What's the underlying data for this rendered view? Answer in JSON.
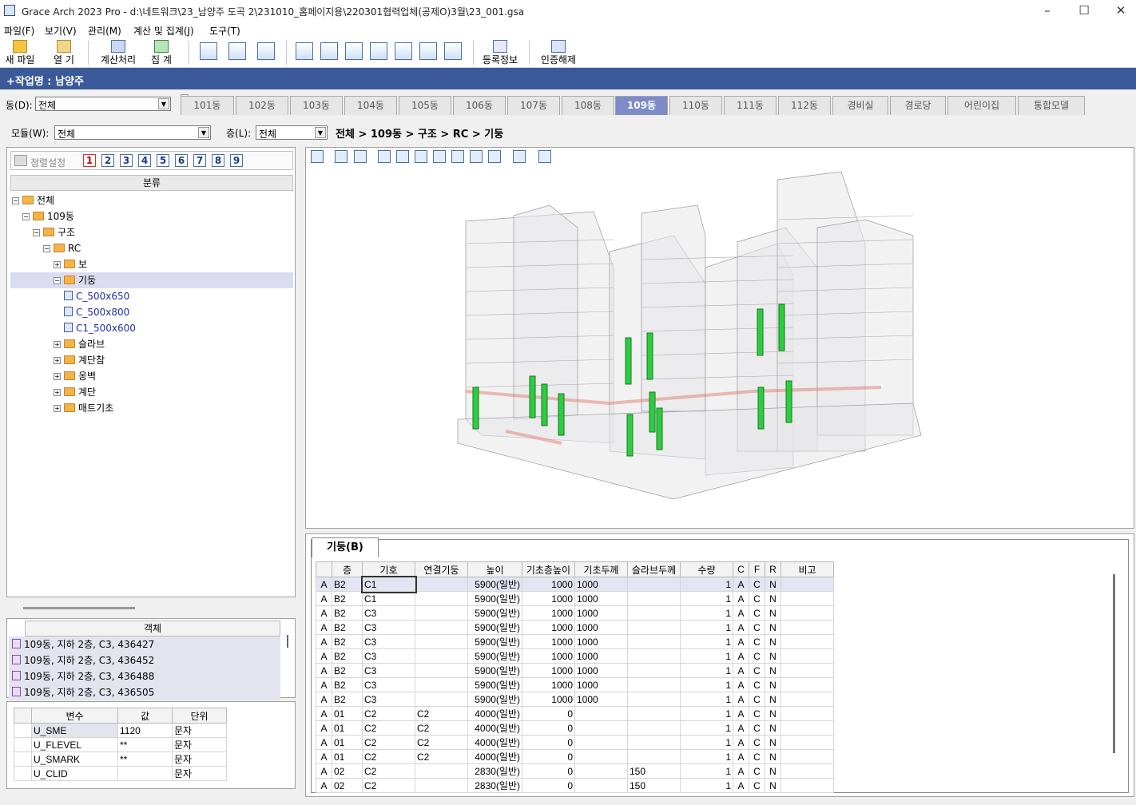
{
  "title": "Grace Arch 2023 Pro - d:\\네트워크\\23_남양주 도곡 2\\231010_홈페이지용\\220301협력업체(공제O)3월\\23_001.gsa",
  "menu": [
    "파일(F)",
    "보기(V)",
    "관리(M)",
    "계산 및 집계(J)",
    "도구(T)"
  ],
  "toolbar": {
    "new": "새 파일",
    "open": "열 기",
    "calc": "계산처리",
    "sum": "집 계",
    "reg": "등록정보",
    "auth": "인증해제"
  },
  "work": "+작업명 : 남양주",
  "dong_label": "동(D):",
  "dong_value": "전체",
  "tabs": [
    "101동",
    "102동",
    "103동",
    "104동",
    "105동",
    "106동",
    "107동",
    "108동",
    "109동",
    "110동",
    "111동",
    "112동",
    "경비실",
    "경로당",
    "어린이집",
    "통합모델"
  ],
  "module_label": "모듈(W):",
  "module_value": "전체",
  "floor_label": "층(L):",
  "floor_value": "전체",
  "breadcrumb": "전체 > 109동 > 구조 > RC > 기둥",
  "sort_label": "정렬설정",
  "sort_nums": [
    "1",
    "2",
    "3",
    "4",
    "5",
    "6",
    "7",
    "8",
    "9"
  ],
  "tree_header": "분류",
  "tree": [
    "전체",
    "109동",
    "구조",
    "RC",
    "보",
    "기둥",
    "C_500x650",
    "C_500x800",
    "C1_500x600",
    "슬라브",
    "계단참",
    "옹벽",
    "계단",
    "매트기초"
  ],
  "obj_header": "객체",
  "objects": [
    "109동, 지하 2층, C3, 436427",
    "109동, 지하 2층, C3, 436452",
    "109동, 지하 2층, C3, 436488",
    "109동, 지하 2층, C3, 436505"
  ],
  "var_headers": [
    "변수",
    "값",
    "단위"
  ],
  "vars": [
    [
      "U_SME",
      "1120",
      "문자"
    ],
    [
      "U_FLEVEL",
      "**",
      "문자"
    ],
    [
      "U_SMARK",
      "**",
      "문자"
    ],
    [
      "U_CLID",
      "",
      "문자"
    ]
  ],
  "bottom_tab": "기둥(B)",
  "table_headers": [
    "층",
    "기호",
    "연결기둥",
    "높이",
    "기초층높이",
    "기초두께",
    "슬라브두께",
    "수량",
    "C",
    "F",
    "R",
    "비고"
  ],
  "rows": [
    [
      "A",
      "B2",
      "C1",
      "",
      "5900(일반)",
      "1000",
      "1000",
      "",
      "1",
      "A",
      "C",
      "N"
    ],
    [
      "A",
      "B2",
      "C1",
      "",
      "5900(일반)",
      "1000",
      "1000",
      "",
      "1",
      "A",
      "C",
      "N"
    ],
    [
      "A",
      "B2",
      "C3",
      "",
      "5900(일반)",
      "1000",
      "1000",
      "",
      "1",
      "A",
      "C",
      "N"
    ],
    [
      "A",
      "B2",
      "C3",
      "",
      "5900(일반)",
      "1000",
      "1000",
      "",
      "1",
      "A",
      "C",
      "N"
    ],
    [
      "A",
      "B2",
      "C3",
      "",
      "5900(일반)",
      "1000",
      "1000",
      "",
      "1",
      "A",
      "C",
      "N"
    ],
    [
      "A",
      "B2",
      "C3",
      "",
      "5900(일반)",
      "1000",
      "1000",
      "",
      "1",
      "A",
      "C",
      "N"
    ],
    [
      "A",
      "B2",
      "C3",
      "",
      "5900(일반)",
      "1000",
      "1000",
      "",
      "1",
      "A",
      "C",
      "N"
    ],
    [
      "A",
      "B2",
      "C3",
      "",
      "5900(일반)",
      "1000",
      "1000",
      "",
      "1",
      "A",
      "C",
      "N"
    ],
    [
      "A",
      "B2",
      "C3",
      "",
      "5900(일반)",
      "1000",
      "1000",
      "",
      "1",
      "A",
      "C",
      "N"
    ],
    [
      "A",
      "01",
      "C2",
      "C2",
      "4000(일반)",
      "0",
      "",
      "",
      "1",
      "A",
      "C",
      "N"
    ],
    [
      "A",
      "01",
      "C2",
      "C2",
      "4000(일반)",
      "0",
      "",
      "",
      "1",
      "A",
      "C",
      "N"
    ],
    [
      "A",
      "01",
      "C2",
      "C2",
      "4000(일반)",
      "0",
      "",
      "",
      "1",
      "A",
      "C",
      "N"
    ],
    [
      "A",
      "01",
      "C2",
      "C2",
      "4000(일반)",
      "0",
      "",
      "",
      "1",
      "A",
      "C",
      "N"
    ],
    [
      "A",
      "02",
      "C2",
      "",
      "2830(일반)",
      "0",
      "",
      "150",
      "1",
      "A",
      "C",
      "N"
    ],
    [
      "A",
      "02",
      "C2",
      "",
      "2830(일반)",
      "0",
      "",
      "150",
      "1",
      "A",
      "C",
      "N"
    ]
  ],
  "colors": {
    "accent": "#3b5998",
    "selected_tab": "#7d8bc9",
    "column": "#2ecc40"
  }
}
